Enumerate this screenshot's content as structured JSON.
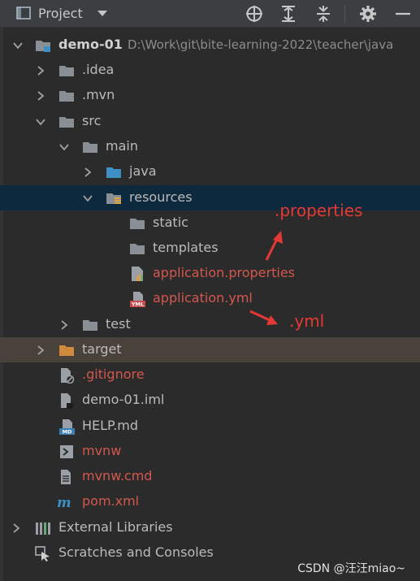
{
  "toolbar": {
    "title": "Project",
    "icons": [
      "project-view-icon",
      "dropdown-caret-icon",
      "locate-icon",
      "expand-all-icon",
      "collapse-all-icon",
      "gear-icon",
      "hide-icon"
    ]
  },
  "tree": {
    "root": {
      "label": "demo-01",
      "path": "D:\\Work\\git\\bite-learning-2022\\teacher\\java"
    },
    "idea": ".idea",
    "mvn": ".mvn",
    "src": "src",
    "main": "main",
    "java": "java",
    "resources": "resources",
    "static": "static",
    "templates": "templates",
    "app_properties": "application.properties",
    "app_yml": "application.yml",
    "test": "test",
    "target": "target",
    "gitignore": ".gitignore",
    "iml": "demo-01.iml",
    "help": "HELP.md",
    "mvnw": "mvnw",
    "mvnw_cmd": "mvnw.cmd",
    "pom": "pom.xml",
    "external_libraries": "External Libraries",
    "scratches": "Scratches and Consoles"
  },
  "annotations": {
    "properties": ".properties",
    "yml": ".yml"
  },
  "watermark": "CSDN @汪汪miao~",
  "colors": {
    "background": "#2b2b2b",
    "selected_row": "#0d293e",
    "excluded_row": "#48423a",
    "untracked_file": "#d4574e",
    "annotation": "#e53935",
    "folder": "#8a8f95",
    "source_folder": "#3d8fc4",
    "excluded_folder": "#d08a3e"
  }
}
